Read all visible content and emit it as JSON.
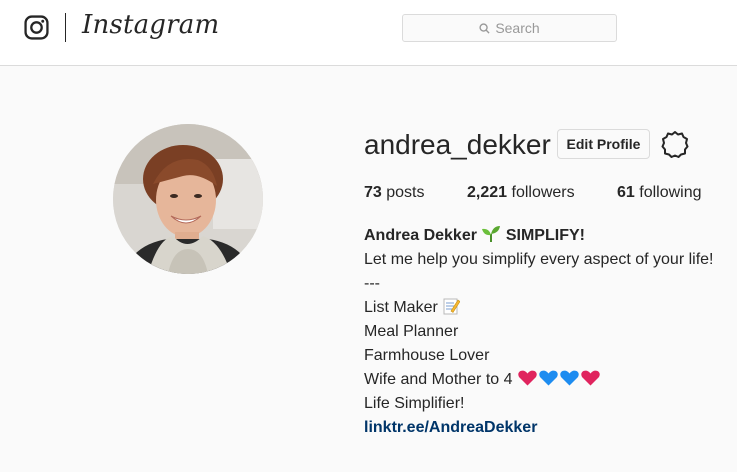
{
  "header": {
    "brand": "Instagram",
    "search_placeholder": "Search"
  },
  "profile": {
    "username": "andrea_dekker",
    "edit_button": "Edit Profile",
    "stats": {
      "posts_count": "73",
      "posts_label": "posts",
      "followers_count": "2,221",
      "followers_label": "followers",
      "following_count": "61",
      "following_label": "following"
    },
    "bio": {
      "display_name": "Andrea Dekker",
      "name_suffix": "SIMPLIFY!",
      "line1": "Let me help you simplify every aspect of your life!",
      "line2": "---",
      "line3": "List Maker",
      "line4": "Meal Planner",
      "line5": "Farmhouse Lover",
      "line6": "Wife and Mother to 4",
      "line7": "Life Simplifier!",
      "link": "linktr.ee/AndreaDekker"
    }
  },
  "colors": {
    "text": "#262626",
    "link": "#003569",
    "border": "#dbdbdb",
    "background": "#fafafa",
    "heart_red": "#e0245e",
    "heart_blue": "#1d8cf0"
  },
  "icons": [
    "instagram-camera-icon",
    "search-icon",
    "settings-gear-icon",
    "seedling-emoji",
    "memo-emoji",
    "red-heart-emoji",
    "blue-heart-emoji"
  ]
}
